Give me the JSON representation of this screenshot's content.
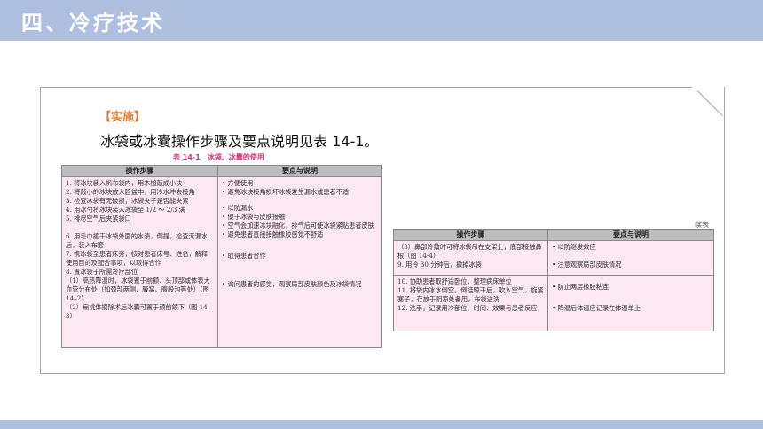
{
  "header": {
    "title": "四、冷疗技术"
  },
  "content": {
    "section_label": "【实施】",
    "intro": "冰袋或冰囊操作步骤及要点说明见表 14-1。",
    "table_caption": "表 14-1　冰袋、冰囊的使用",
    "continued_label": "续表"
  },
  "table1": {
    "headers": [
      "操作步骤",
      "要点与说明"
    ],
    "steps": [
      "1. 将冰块装入帆布袋内，用木槌敲成小块",
      "2. 将敲小的冰块放入脸盆中，用冷水冲去棱角",
      "3. 检查冰袋有无破损，冰袋夹子是否能夹紧",
      "4. 用冰勺将冰块装入冰袋至 1/2 ～ 2/3 满",
      "5. 排尽空气后夹紧袋口",
      "",
      "6. 用毛巾擦干冰袋外面的水渍，倒提，检查无漏水后，装入布套",
      "7. 携冰袋至患者床旁，核对患者床号、姓名，解释使用目的及配合事项，以取得合作",
      "8. 置冰袋于所需冷疗部位",
      "（1）高热降温时，冰袋置于前额、头顶部或体表大血管分布处（如颈部两侧、腋窝、腹股沟等处）（图 14–2）",
      "（2）扁桃体摘除术后冰囊可置于颈前颌下（图 14–3）"
    ],
    "notes": [
      "• 方便使用",
      "• 避免冰块棱角损坏冰袋发生漏水或患者不适",
      "",
      "• 以防漏水",
      "• 便于冰袋与皮肤接触",
      "• 空气会加速冰块融化，排气后可使冰袋紧贴患者皮肤",
      "• 避免患者直接接触橡胶感觉不舒适",
      "",
      "• 取得患者合作",
      "",
      "• 询问患者的感觉，观察局部皮肤颜色及冰袋情况"
    ]
  },
  "table2": {
    "headers": [
      "操作步骤",
      "要点与说明"
    ],
    "rows": [
      {
        "steps": [
          "（3）鼻部冷敷时可将冰袋吊在支架上，底部接触鼻根（图 14-4）",
          "9. 用冷 30 分钟后，撤掉冰袋"
        ],
        "notes": [
          "• 以防继发效应",
          "• 注意观察局部皮肤情况"
        ]
      },
      {
        "steps": [
          "10. 协助患者取舒适卧位，整理病床单位",
          "11. 将袋内冰水倒空，倒挂晾干后，吹入空气，旋紧塞子，存放于阴凉处备用，布袋送洗",
          "12. 洗手，记录用冷部位、时间、效果与患者反应"
        ],
        "notes": [
          "• 防止两层橡胶粘连",
          "• 降温后体温应记录在体温单上"
        ]
      }
    ]
  }
}
